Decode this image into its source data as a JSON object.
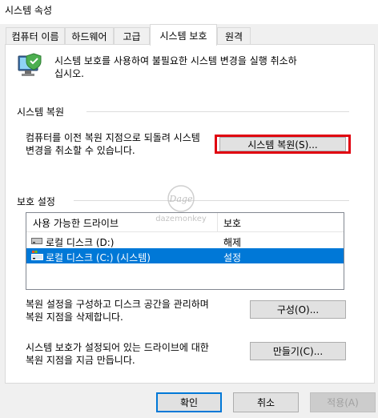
{
  "window": {
    "title": "시스템 속성"
  },
  "tabs": [
    {
      "label": "컴퓨터 이름"
    },
    {
      "label": "하드웨어"
    },
    {
      "label": "고급"
    },
    {
      "label": "시스템 보호"
    },
    {
      "label": "원격"
    }
  ],
  "intro": {
    "text_line1": "시스템 보호를 사용하여 불필요한 시스템 변경을 실행 취소하",
    "text_line2": "십시오."
  },
  "restore": {
    "section_title": "시스템 복원",
    "desc_line1": "컴퓨터를 이전 복원 지점으로 되돌려 시스템",
    "desc_line2": "변경을 취소할 수 있습니다.",
    "button_label": "시스템 복원(S)..."
  },
  "protection": {
    "section_title": "보호 설정",
    "columns": [
      "사용 가능한 드라이브",
      "보호"
    ],
    "drives": [
      {
        "name": "로컬 디스크 (D:)",
        "status": "해제"
      },
      {
        "name": "로컬 디스크 (C:) (시스템)",
        "status": "설정"
      }
    ],
    "configure_desc_line1": "복원 설정을 구성하고 디스크 공간을 관리하며",
    "configure_desc_line2": "복원 지점을 삭제합니다.",
    "configure_button": "구성(O)...",
    "create_desc_line1": "시스템 보호가 설정되어 있는 드라이브에 대한",
    "create_desc_line2": "복원 지점을 지금 만듭니다.",
    "create_button": "만들기(C)..."
  },
  "watermark": {
    "logo": "Dage",
    "text": "dazemonkey"
  },
  "footer": {
    "ok": "확인",
    "cancel": "취소",
    "apply": "적용(A)"
  },
  "icons": {
    "system_icon": "computer-shield-icon",
    "drive_icon": "hard-drive-icon",
    "system_drive_icon": "system-drive-icon"
  }
}
